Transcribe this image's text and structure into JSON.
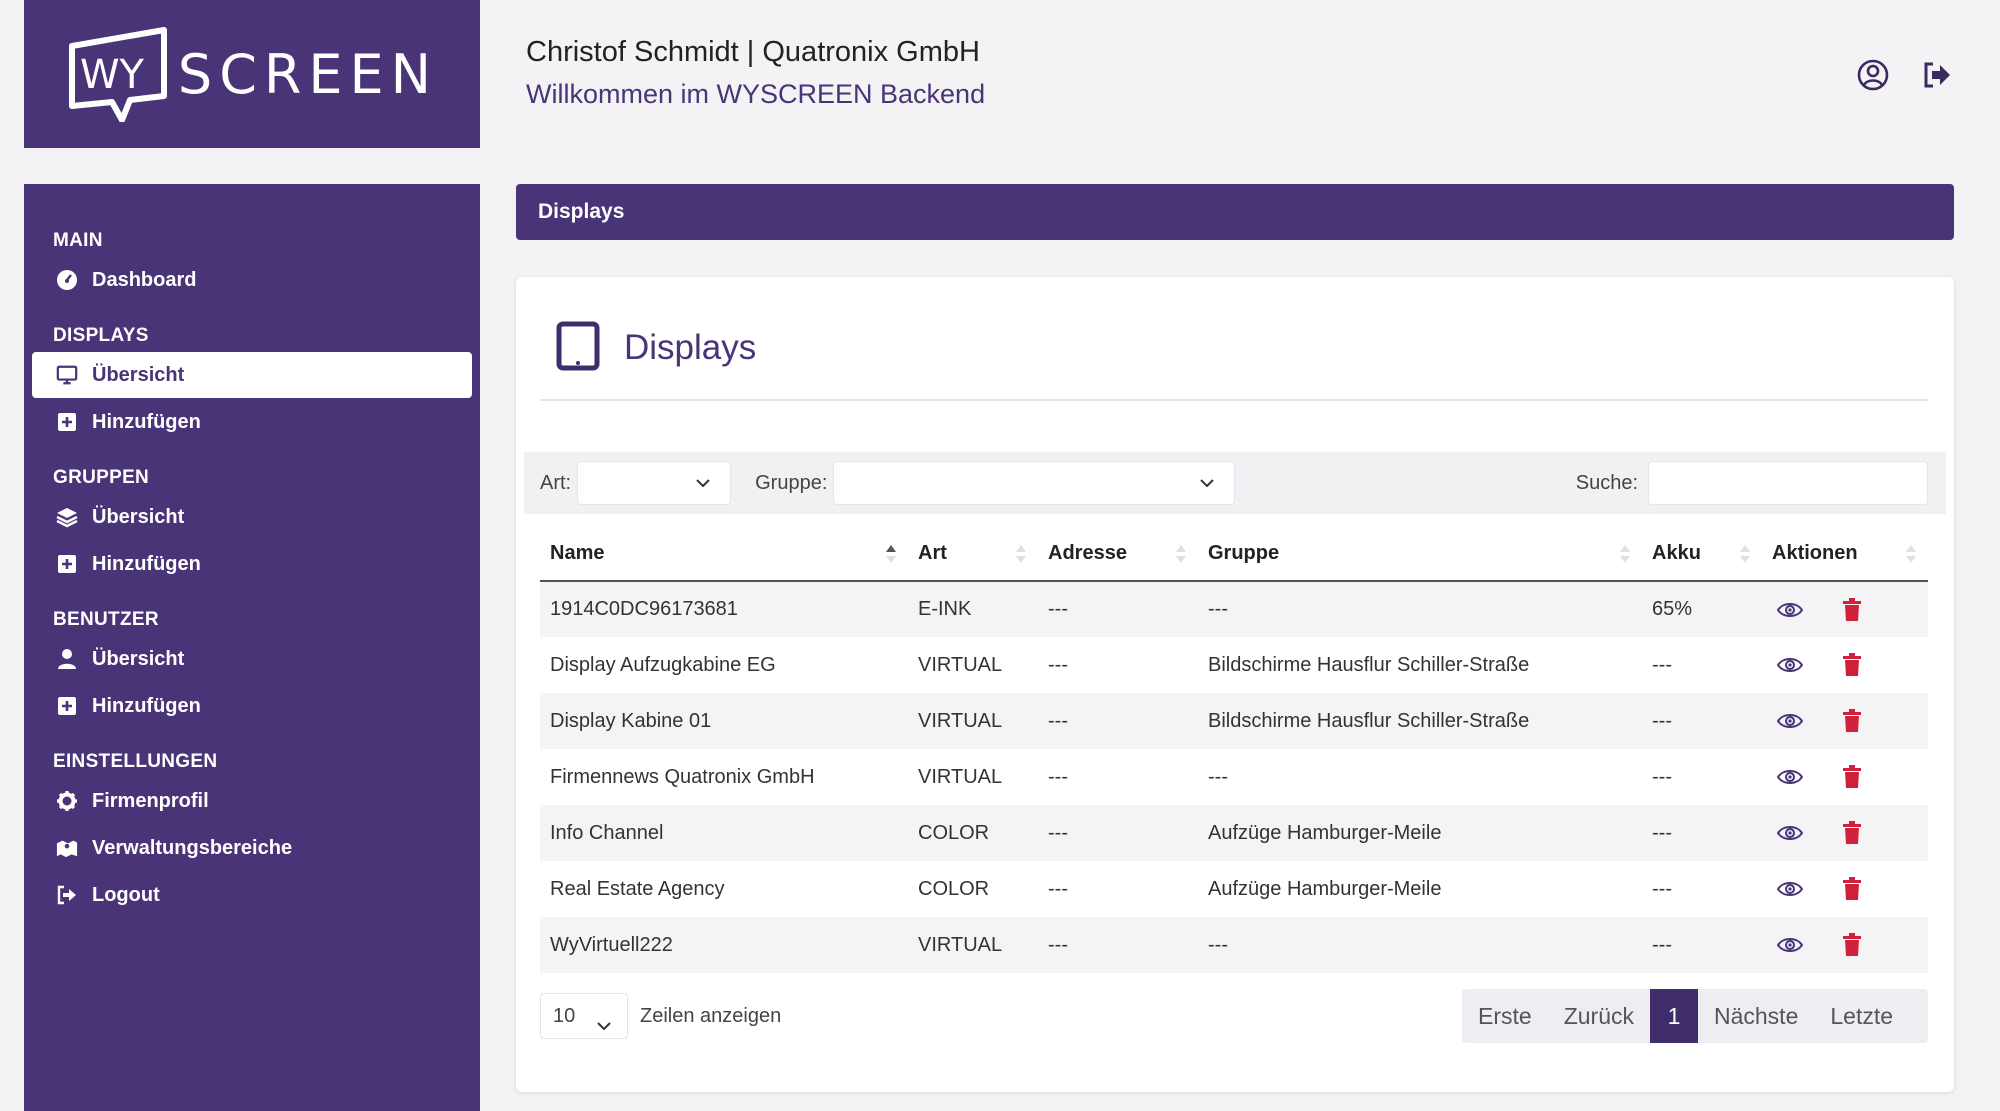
{
  "brand": {
    "logo_letters": "WY",
    "logo_text": "SCREEN"
  },
  "header": {
    "user": "Christof Schmidt | Quatronix GmbH",
    "welcome": "Willkommen im WYSCREEN Backend"
  },
  "sidebar": {
    "sections": [
      {
        "title": "MAIN",
        "items": [
          {
            "label": "Dashboard",
            "icon": "dashboard-icon"
          }
        ]
      },
      {
        "title": "DISPLAYS",
        "items": [
          {
            "label": "Übersicht",
            "icon": "monitor-icon",
            "active": true
          },
          {
            "label": "Hinzufügen",
            "icon": "plus-square-icon"
          }
        ]
      },
      {
        "title": "GRUPPEN",
        "items": [
          {
            "label": "Übersicht",
            "icon": "layers-icon"
          },
          {
            "label": "Hinzufügen",
            "icon": "plus-square-icon"
          }
        ]
      },
      {
        "title": "BENUTZER",
        "items": [
          {
            "label": "Übersicht",
            "icon": "user-icon"
          },
          {
            "label": "Hinzufügen",
            "icon": "plus-square-icon"
          }
        ]
      },
      {
        "title": "EINSTELLUNGEN",
        "items": [
          {
            "label": "Firmenprofil",
            "icon": "gear-icon"
          },
          {
            "label": "Verwaltungsbereiche",
            "icon": "map-icon"
          },
          {
            "label": "Logout",
            "icon": "logout-icon"
          }
        ]
      }
    ]
  },
  "titlebar": {
    "label": "Displays"
  },
  "card": {
    "title": "Displays"
  },
  "filters": {
    "art_label": "Art:",
    "art_value": "",
    "gruppe_label": "Gruppe:",
    "gruppe_value": "",
    "search_label": "Suche:",
    "search_value": ""
  },
  "table": {
    "columns": [
      "Name",
      "Art",
      "Adresse",
      "Gruppe",
      "Akku",
      "Aktionen"
    ],
    "rows": [
      [
        "1914C0DC96173681",
        "E-INK",
        "---",
        "---",
        "65%"
      ],
      [
        "Display Aufzugkabine EG",
        "VIRTUAL",
        "---",
        "Bildschirme Hausflur Schiller-Straße",
        "---"
      ],
      [
        "Display Kabine 01",
        "VIRTUAL",
        "---",
        "Bildschirme Hausflur Schiller-Straße",
        "---"
      ],
      [
        "Firmennews Quatronix GmbH",
        "VIRTUAL",
        "---",
        "---",
        "---"
      ],
      [
        "Info Channel",
        "COLOR",
        "---",
        "Aufzüge Hamburger-Meile",
        "---"
      ],
      [
        "Real Estate Agency",
        "COLOR",
        "---",
        "Aufzüge Hamburger-Meile",
        "---"
      ],
      [
        "WyVirtuell222",
        "VIRTUAL",
        "---",
        "---",
        "---"
      ]
    ]
  },
  "footer": {
    "page_length": "10",
    "page_length_label": "Zeilen anzeigen",
    "pager": {
      "first": "Erste",
      "prev": "Zurück",
      "current": "1",
      "next": "Nächste",
      "last": "Letzte"
    }
  },
  "colors": {
    "brand": "#4a3478",
    "delete": "#d0213c",
    "view": "#4a3478"
  }
}
